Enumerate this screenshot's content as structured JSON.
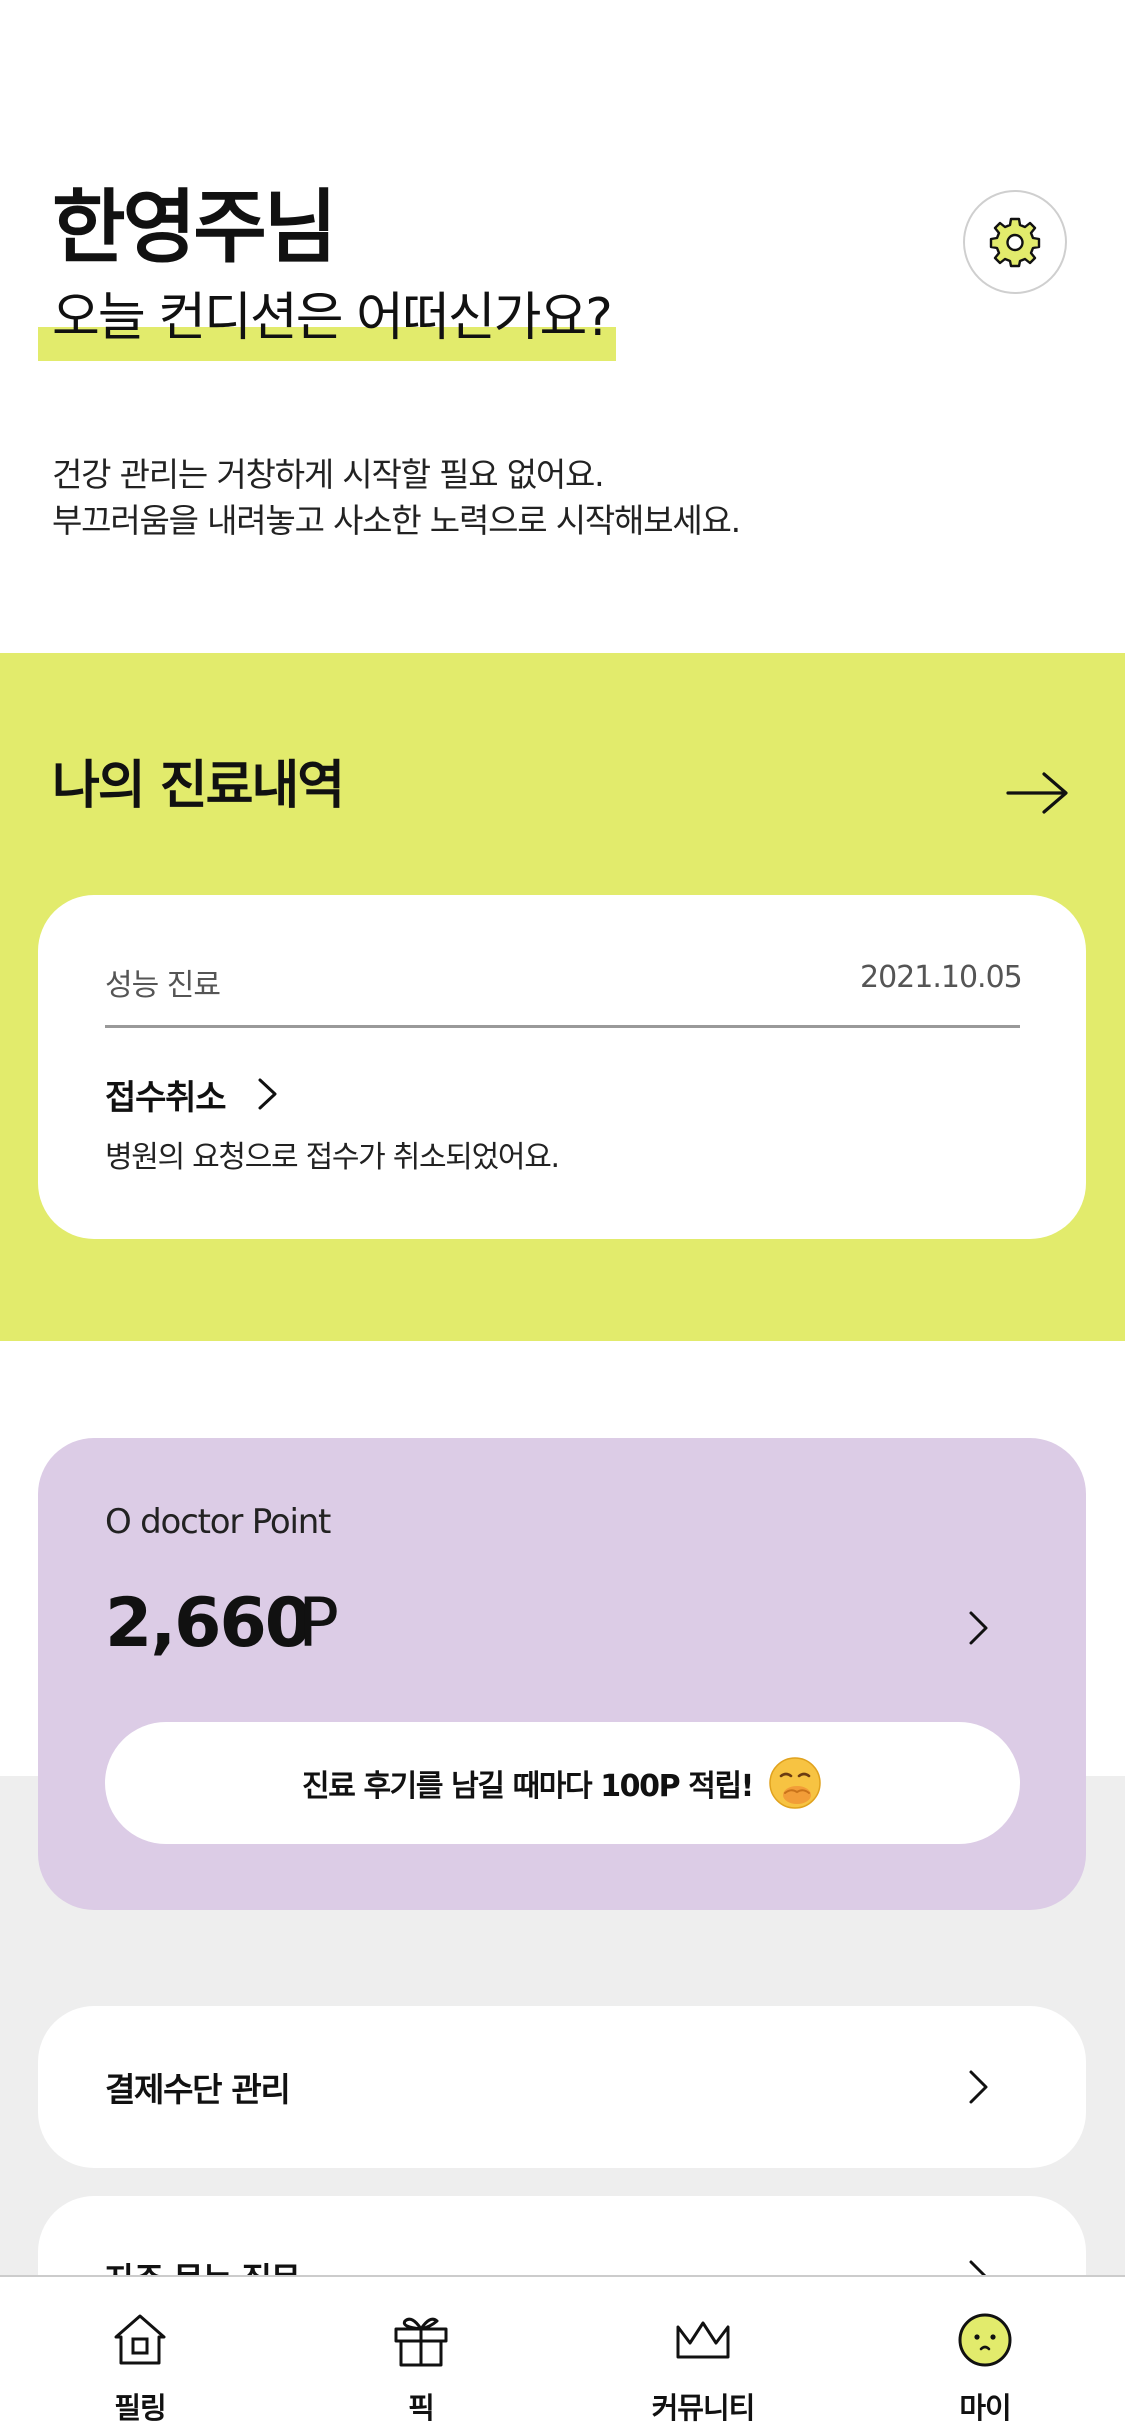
{
  "greeting": {
    "name": "한영주님",
    "question": "오늘 컨디션은 어떠신가요?",
    "intro_line1": "건강 관리는 거창하게 시작할 필요 없어요.",
    "intro_line2": "부끄러움을 내려놓고 사소한 노력으로 시작해보세요."
  },
  "history": {
    "title": "나의 진료내역",
    "card": {
      "type": "성능 진료",
      "date": "2021.10.05",
      "status": "접수취소",
      "message": "병원의 요청으로 접수가 취소되었어요."
    }
  },
  "points": {
    "label": "O doctor Point",
    "value": "2,660",
    "unit": "P",
    "banner": "진료 후기를 남길 때마다 100P 적립!",
    "banner_emoji": "🤭"
  },
  "menu": [
    {
      "label": "결제수단 관리"
    },
    {
      "label": "자주 묻는 질문"
    }
  ],
  "tabs": [
    {
      "label": "필링",
      "icon": "home-icon"
    },
    {
      "label": "픽",
      "icon": "gift-icon"
    },
    {
      "label": "커뮤니티",
      "icon": "crown-icon"
    },
    {
      "label": "마이",
      "icon": "face-icon"
    }
  ],
  "colors": {
    "accent_yellow": "#e2eb6c",
    "points_purple": "#dccce6",
    "lower_gray": "#eeeeee"
  }
}
